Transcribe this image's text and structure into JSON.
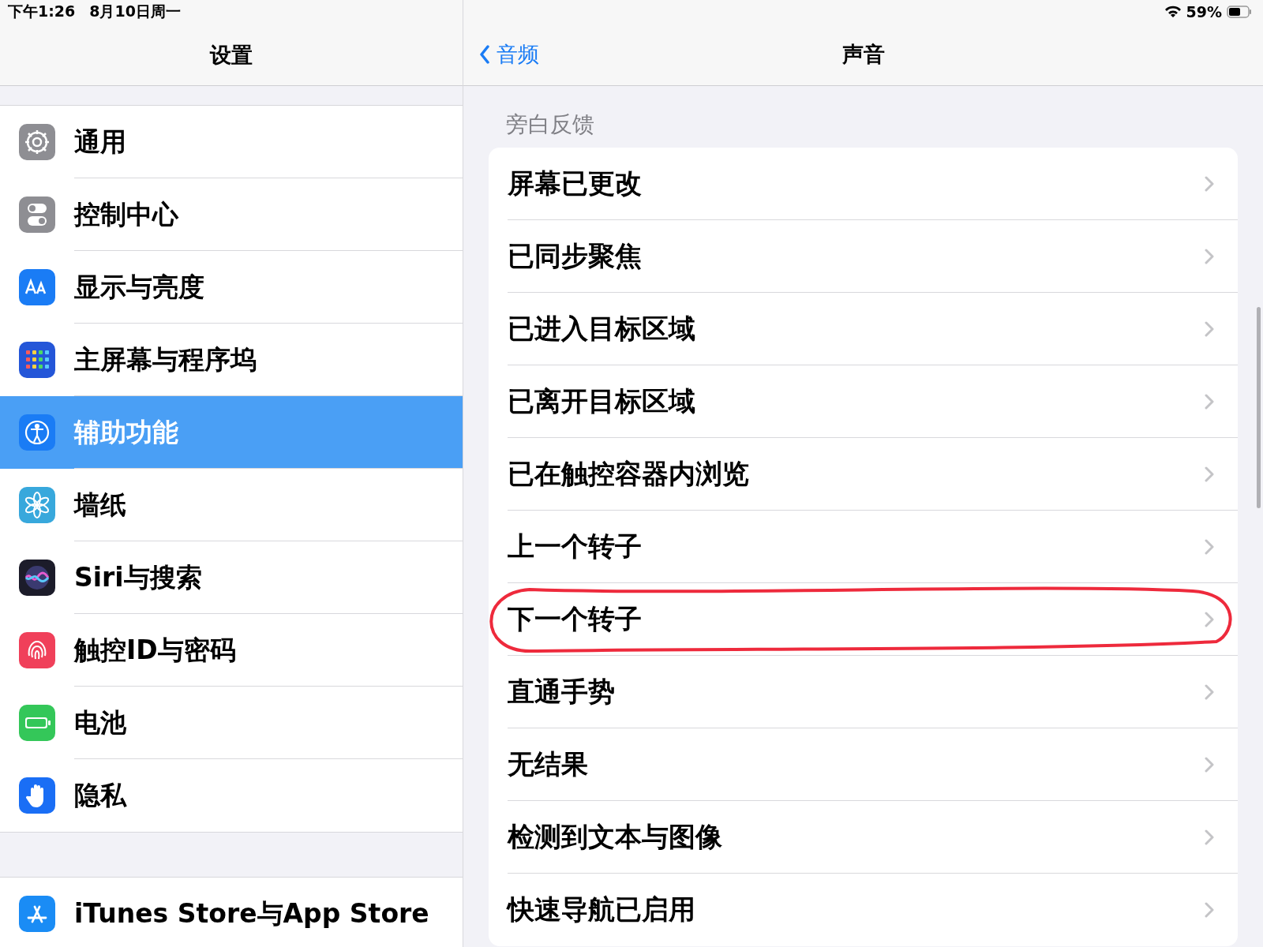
{
  "status_bar": {
    "time": "下午1:26",
    "date": "8月10日周一",
    "battery_text": "59%"
  },
  "sidebar": {
    "title": "设置",
    "groups": [
      {
        "items": [
          {
            "label": "通用",
            "kind": "gear",
            "selected": false
          },
          {
            "label": "控制中心",
            "kind": "toggles",
            "selected": false
          },
          {
            "label": "显示与亮度",
            "kind": "text-size",
            "selected": false
          },
          {
            "label": "主屏幕与程序坞",
            "kind": "grid",
            "selected": false
          },
          {
            "label": "辅助功能",
            "kind": "accessibility",
            "selected": true
          },
          {
            "label": "墙纸",
            "kind": "flower",
            "selected": false
          },
          {
            "label": "Siri与搜索",
            "kind": "siri",
            "selected": false
          },
          {
            "label": "触控ID与密码",
            "kind": "fingerprint",
            "selected": false
          },
          {
            "label": "电池",
            "kind": "battery",
            "selected": false
          },
          {
            "label": "隐私",
            "kind": "hand",
            "selected": false
          }
        ]
      },
      {
        "items": [
          {
            "label": "iTunes Store与App Store",
            "kind": "appstore",
            "selected": false
          }
        ]
      }
    ]
  },
  "detail": {
    "back": "音频",
    "title": "声音",
    "section": "旁白反馈",
    "rows": [
      {
        "label": "屏幕已更改",
        "highlighted": false
      },
      {
        "label": "已同步聚焦",
        "highlighted": false
      },
      {
        "label": "已进入目标区域",
        "highlighted": false
      },
      {
        "label": "已离开目标区域",
        "highlighted": false
      },
      {
        "label": "已在触控容器内浏览",
        "highlighted": false
      },
      {
        "label": "上一个转子",
        "highlighted": false
      },
      {
        "label": "下一个转子",
        "highlighted": true
      },
      {
        "label": "直通手势",
        "highlighted": false
      },
      {
        "label": "无结果",
        "highlighted": false
      },
      {
        "label": "检测到文本与图像",
        "highlighted": false
      },
      {
        "label": "快速导航已启用",
        "highlighted": false
      }
    ]
  }
}
